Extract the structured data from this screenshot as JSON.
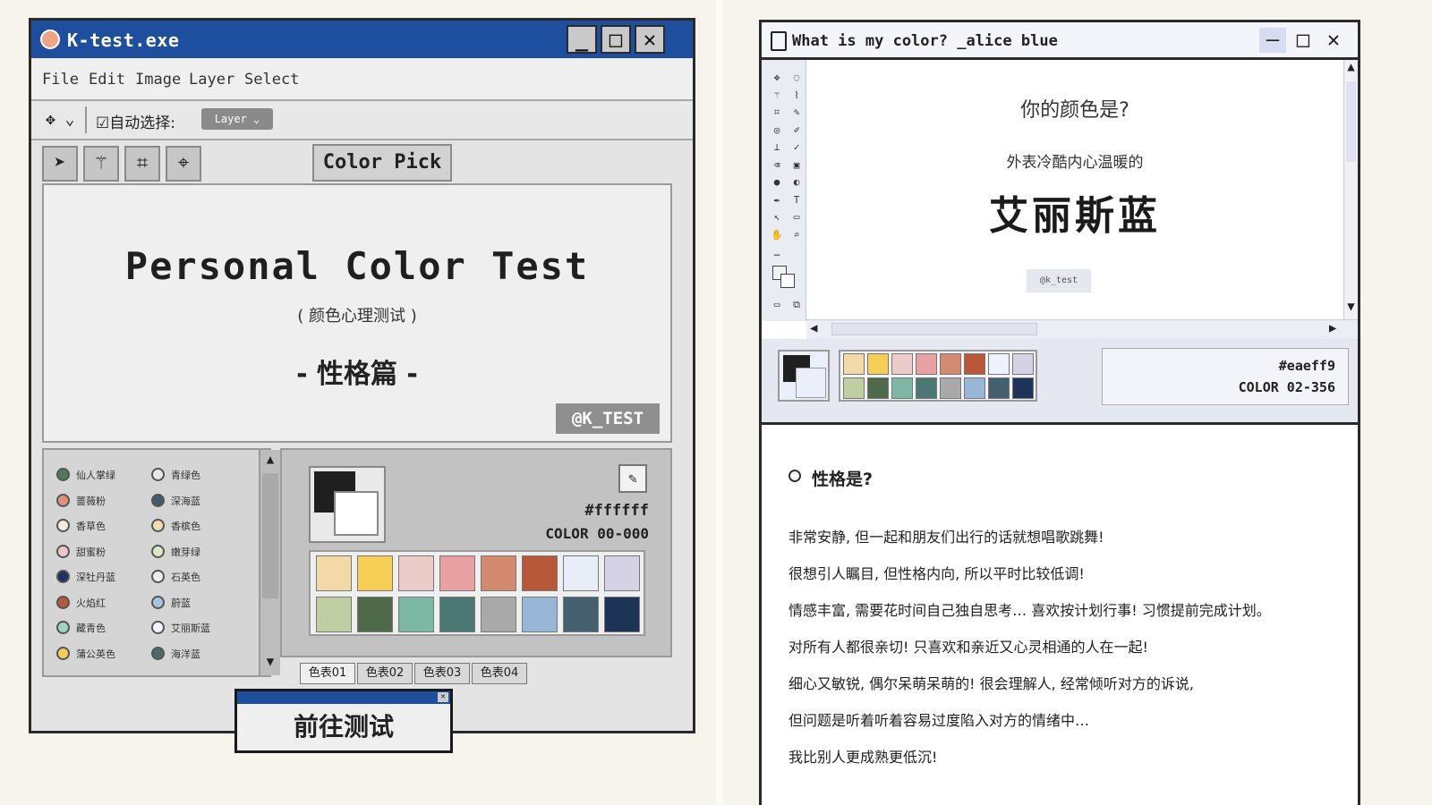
{
  "left_window": {
    "title": "K-test.exe",
    "menu": [
      "File",
      "Edit",
      "Image",
      "Layer",
      "Select"
    ],
    "options": {
      "move_symbol": "✥ ⌄",
      "auto_select": "☑自动选择:",
      "layer_dropdown": "Layer ⌄"
    },
    "tools": {
      "color_pick_label": "Color Pick ☒"
    },
    "canvas": {
      "title": "Personal Color Test",
      "subtitle": "( 颜色心理测试 )",
      "chapter": "- 性格篇 -",
      "tag": "@K_TEST"
    },
    "color_list": [
      {
        "name": "仙人掌绿",
        "color": "#4e7a5a",
        "filled": true
      },
      {
        "name": "青绿色",
        "color": "#e8e8e8",
        "filled": false
      },
      {
        "name": "蔷薇粉",
        "color": "#e0907a",
        "filled": true
      },
      {
        "name": "深海蓝",
        "color": "#3f5d6a",
        "filled": true
      },
      {
        "name": "香草色",
        "color": "#f4eadb",
        "filled": false
      },
      {
        "name": "香槟色",
        "color": "#f1dcb0",
        "filled": false
      },
      {
        "name": "甜蜜粉",
        "color": "#efc6c8",
        "filled": false
      },
      {
        "name": "嫩芽绿",
        "color": "#dbe8c2",
        "filled": false
      },
      {
        "name": "深牡丹蓝",
        "color": "#1d2f63",
        "filled": true
      },
      {
        "name": "石英色",
        "color": "#eeeeee",
        "filled": false
      },
      {
        "name": "火焰红",
        "color": "#b8583a",
        "filled": true
      },
      {
        "name": "蔚蓝",
        "color": "#a9c2df",
        "filled": false
      },
      {
        "name": "藏青色",
        "color": "#9fd4c2",
        "filled": false
      },
      {
        "name": "艾丽斯蓝",
        "color": "#f4f6fb",
        "filled": false
      },
      {
        "name": "蒲公英色",
        "color": "#f6cd55",
        "filled": false
      },
      {
        "name": "海洋蓝",
        "color": "#4b6b6a",
        "filled": true
      }
    ],
    "swatch": {
      "hex": "#ffffff",
      "code": "COLOR 00-000"
    },
    "palette": [
      "#f3d8a8",
      "#f6cd55",
      "#ecccc8",
      "#e8a0a2",
      "#d48a6e",
      "#b8583a",
      "#e8eef8",
      "#d6d2e6",
      "#c0cfa2",
      "#4e6a48",
      "#7cb8a4",
      "#4c7874",
      "#a9a9a9",
      "#98b6d6",
      "#445f6e",
      "#1d3358"
    ],
    "tabs": [
      "色表01",
      "色表02",
      "色表03",
      "色表04"
    ],
    "go_button": "前往测试"
  },
  "right_window": {
    "title": "What is my color? _alice blue",
    "canvas": {
      "question": "你的颜色是?",
      "descriptor": "外表冷酷内心温暖的",
      "color_name": "艾丽斯蓝",
      "tag": "@k_test"
    },
    "swatch": {
      "hex": "#eaeff9",
      "code": "COLOR 02-356"
    },
    "palette": [
      "#f3d8a8",
      "#f6cd55",
      "#ecccc8",
      "#e8a0a2",
      "#d48a6e",
      "#b8583a",
      "#eef2fa",
      "#d6d2e6",
      "#c0cfa2",
      "#4e6a48",
      "#7cb8a4",
      "#4c7874",
      "#a9a9a9",
      "#98b6d6",
      "#445f6e",
      "#1d3358"
    ],
    "personality_heading": "性格是?",
    "personality_lines": [
      "非常安静, 但一起和朋友们出行的话就想唱歌跳舞!",
      "很想引人瞩目, 但性格内向, 所以平时比较低调!",
      "情感丰富, 需要花时间自己独自思考… 喜欢按计划行事! 习惯提前完成计划。",
      "对所有人都很亲切! 只喜欢和亲近又心灵相通的人在一起!",
      "细心又敏锐, 偶尔呆萌呆萌的! 很会理解人, 经常倾听对方的诉说,",
      "但问题是听着听着容易过度陷入对方的情绪中…",
      "我比别人更成熟更低沉!"
    ]
  },
  "colors": {
    "titlebar_blue": "#1e4f9e",
    "window_gray": "#e4e4e4",
    "alice_blue": "#eaeff9"
  }
}
